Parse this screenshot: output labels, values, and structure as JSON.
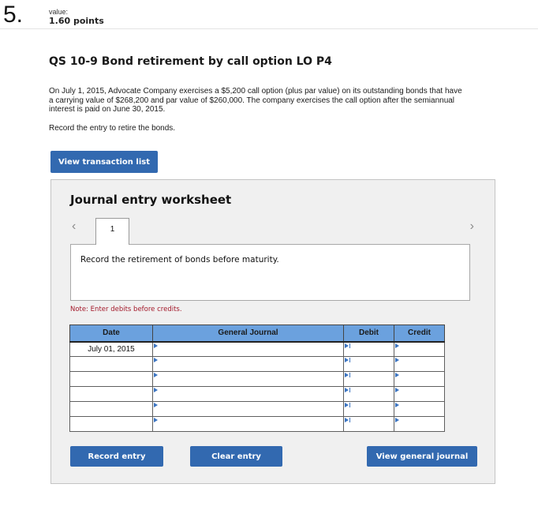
{
  "question": {
    "number": "5.",
    "value_label": "value:",
    "points": "1.60 points"
  },
  "problem": {
    "title": "QS 10-9 Bond retirement by call option LO P4",
    "text": "On July 1, 2015, Advocate Company exercises a $5,200 call option (plus par value) on its outstanding bonds that have a carrying value of $268,200 and par value of $260,000. The company exercises the call option after the semiannual interest is paid on June 30, 2015.",
    "instruction": "Record the entry to retire the bonds."
  },
  "buttons": {
    "view_transaction_list": "View transaction list",
    "record_entry": "Record entry",
    "clear_entry": "Clear entry",
    "view_general_journal": "View general journal"
  },
  "worksheet": {
    "title": "Journal entry worksheet",
    "prev_icon": "‹",
    "next_icon": "›",
    "tabs": [
      {
        "label": "1"
      }
    ],
    "description": "Record the retirement of bonds before maturity.",
    "note": "Note: Enter debits before credits.",
    "columns": {
      "date": "Date",
      "general_journal": "General Journal",
      "debit": "Debit",
      "credit": "Credit"
    },
    "rows": [
      {
        "date": "July 01, 2015",
        "account": "",
        "debit": "",
        "credit": ""
      },
      {
        "date": "",
        "account": "",
        "debit": "",
        "credit": ""
      },
      {
        "date": "",
        "account": "",
        "debit": "",
        "credit": ""
      },
      {
        "date": "",
        "account": "",
        "debit": "",
        "credit": ""
      },
      {
        "date": "",
        "account": "",
        "debit": "",
        "credit": ""
      },
      {
        "date": "",
        "account": "",
        "debit": "",
        "credit": ""
      }
    ]
  },
  "colors": {
    "button_blue": "#3269b0",
    "header_blue": "#6ba1de",
    "note_red": "#a3192a",
    "panel_gray": "#f0f0f0"
  }
}
